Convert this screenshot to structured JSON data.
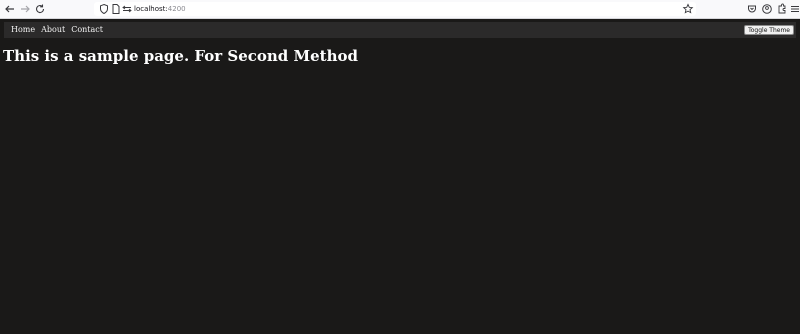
{
  "browser": {
    "url_host": "localhost:",
    "url_port": "4200",
    "icons": {
      "back": "arrow-left-icon",
      "forward": "arrow-right-icon",
      "reload": "reload-icon",
      "shield": "shield-icon",
      "page": "page-icon",
      "permissions": "permissions-icon",
      "bookmark": "star-icon",
      "pocket": "pocket-icon",
      "account": "account-icon",
      "extensions": "extensions-icon",
      "menu": "menu-icon"
    }
  },
  "navbar": {
    "links": [
      "Home",
      "About",
      "Contact"
    ],
    "toggle_label": "Toggle Theme"
  },
  "main": {
    "heading": "This is a sample page. For Second Method"
  },
  "colors": {
    "page_bg": "#1a1918",
    "navbar_bg": "#2b2a2a",
    "text": "#ffffff"
  }
}
